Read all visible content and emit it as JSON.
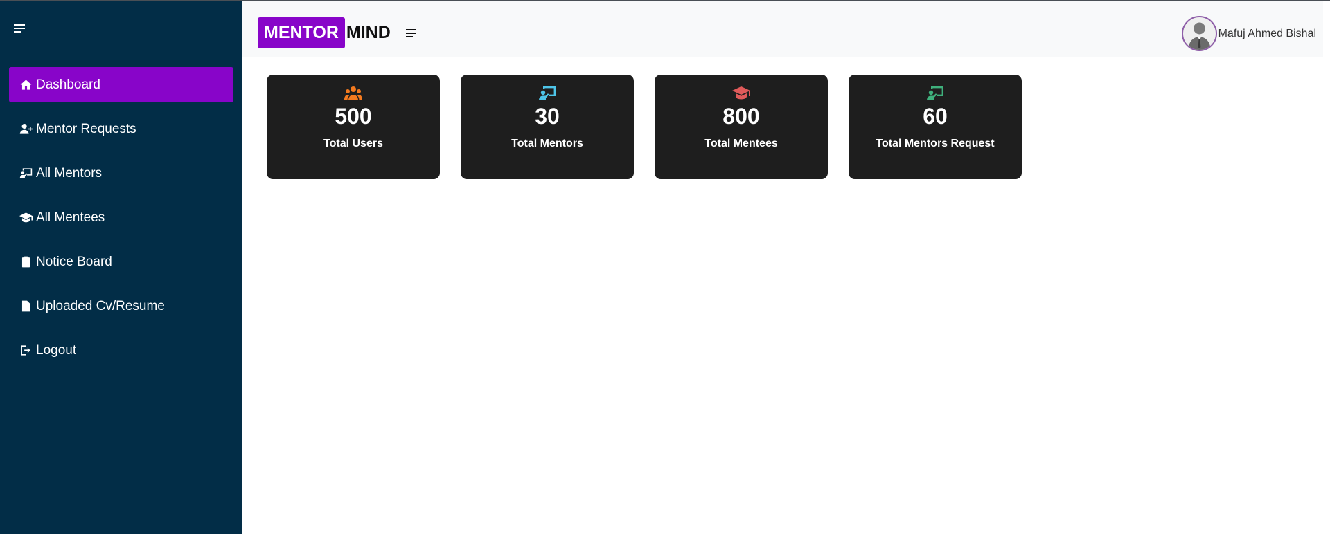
{
  "sidebar": {
    "items": [
      {
        "label": "Dashboard",
        "icon": "home-icon",
        "active": true
      },
      {
        "label": "Mentor Requests",
        "icon": "user-plus-icon",
        "active": false
      },
      {
        "label": "All Mentors",
        "icon": "chalkboard-teacher-icon",
        "active": false
      },
      {
        "label": "All Mentees",
        "icon": "graduation-cap-icon",
        "active": false
      },
      {
        "label": "Notice Board",
        "icon": "clipboard-icon",
        "active": false
      },
      {
        "label": "Uploaded Cv/Resume",
        "icon": "file-icon",
        "active": false
      },
      {
        "label": "Logout",
        "icon": "logout-icon",
        "active": false
      }
    ]
  },
  "header": {
    "logo_primary": "MENTOR",
    "logo_secondary": "MIND",
    "user_name": "Mafuj Ahmed Bishal"
  },
  "stats": [
    {
      "value": "500",
      "label": "Total Users",
      "icon": "users-icon",
      "color": "#f47a1f"
    },
    {
      "value": "30",
      "label": "Total Mentors",
      "icon": "chalkboard-teacher-icon",
      "color": "#4ec5e8"
    },
    {
      "value": "800",
      "label": "Total Mentees",
      "icon": "graduation-cap-icon",
      "color": "#e05a5a"
    },
    {
      "value": "60",
      "label": "Total Mentors Request",
      "icon": "chalkboard-teacher-icon",
      "color": "#3fb07c"
    }
  ],
  "colors": {
    "sidebar_bg": "#022d47",
    "accent": "#8805c9",
    "card_bg": "#1e1e1e"
  }
}
